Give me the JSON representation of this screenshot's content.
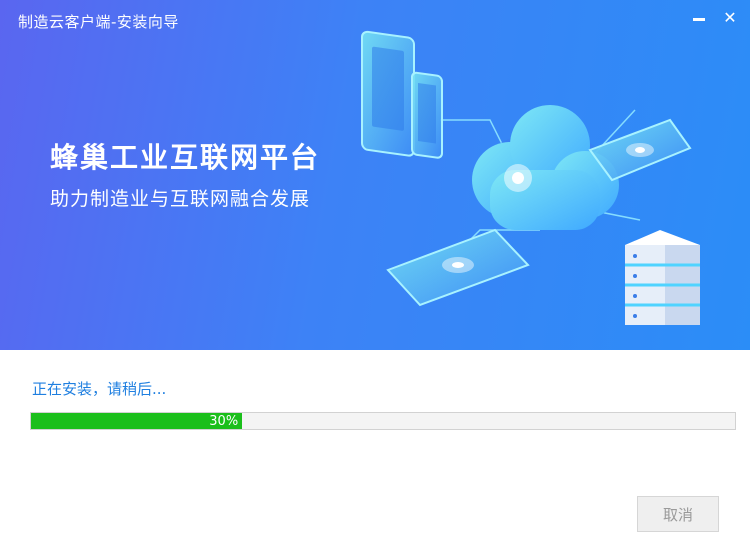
{
  "window": {
    "title": "制造云客户端-安装向导",
    "minimize_icon": "minimize-icon",
    "close_icon": "close-icon"
  },
  "banner": {
    "headline": "蜂巢工业互联网平台",
    "subheadline": "助力制造业与互联网融合发展",
    "illustration_icons": [
      "tablet-icon",
      "phone-icon",
      "cloud-icon",
      "server-icon",
      "tablet-icon",
      "phone-icon"
    ]
  },
  "install": {
    "status": "正在安装，请稍后...",
    "progress_percent": 30,
    "progress_label": "30%"
  },
  "footer": {
    "cancel_label": "取消"
  },
  "colors": {
    "banner_start": "#5a66f0",
    "banner_end": "#2b8df7",
    "status_text": "#1f7fe0",
    "progress_fill": "#1bbf1b"
  }
}
